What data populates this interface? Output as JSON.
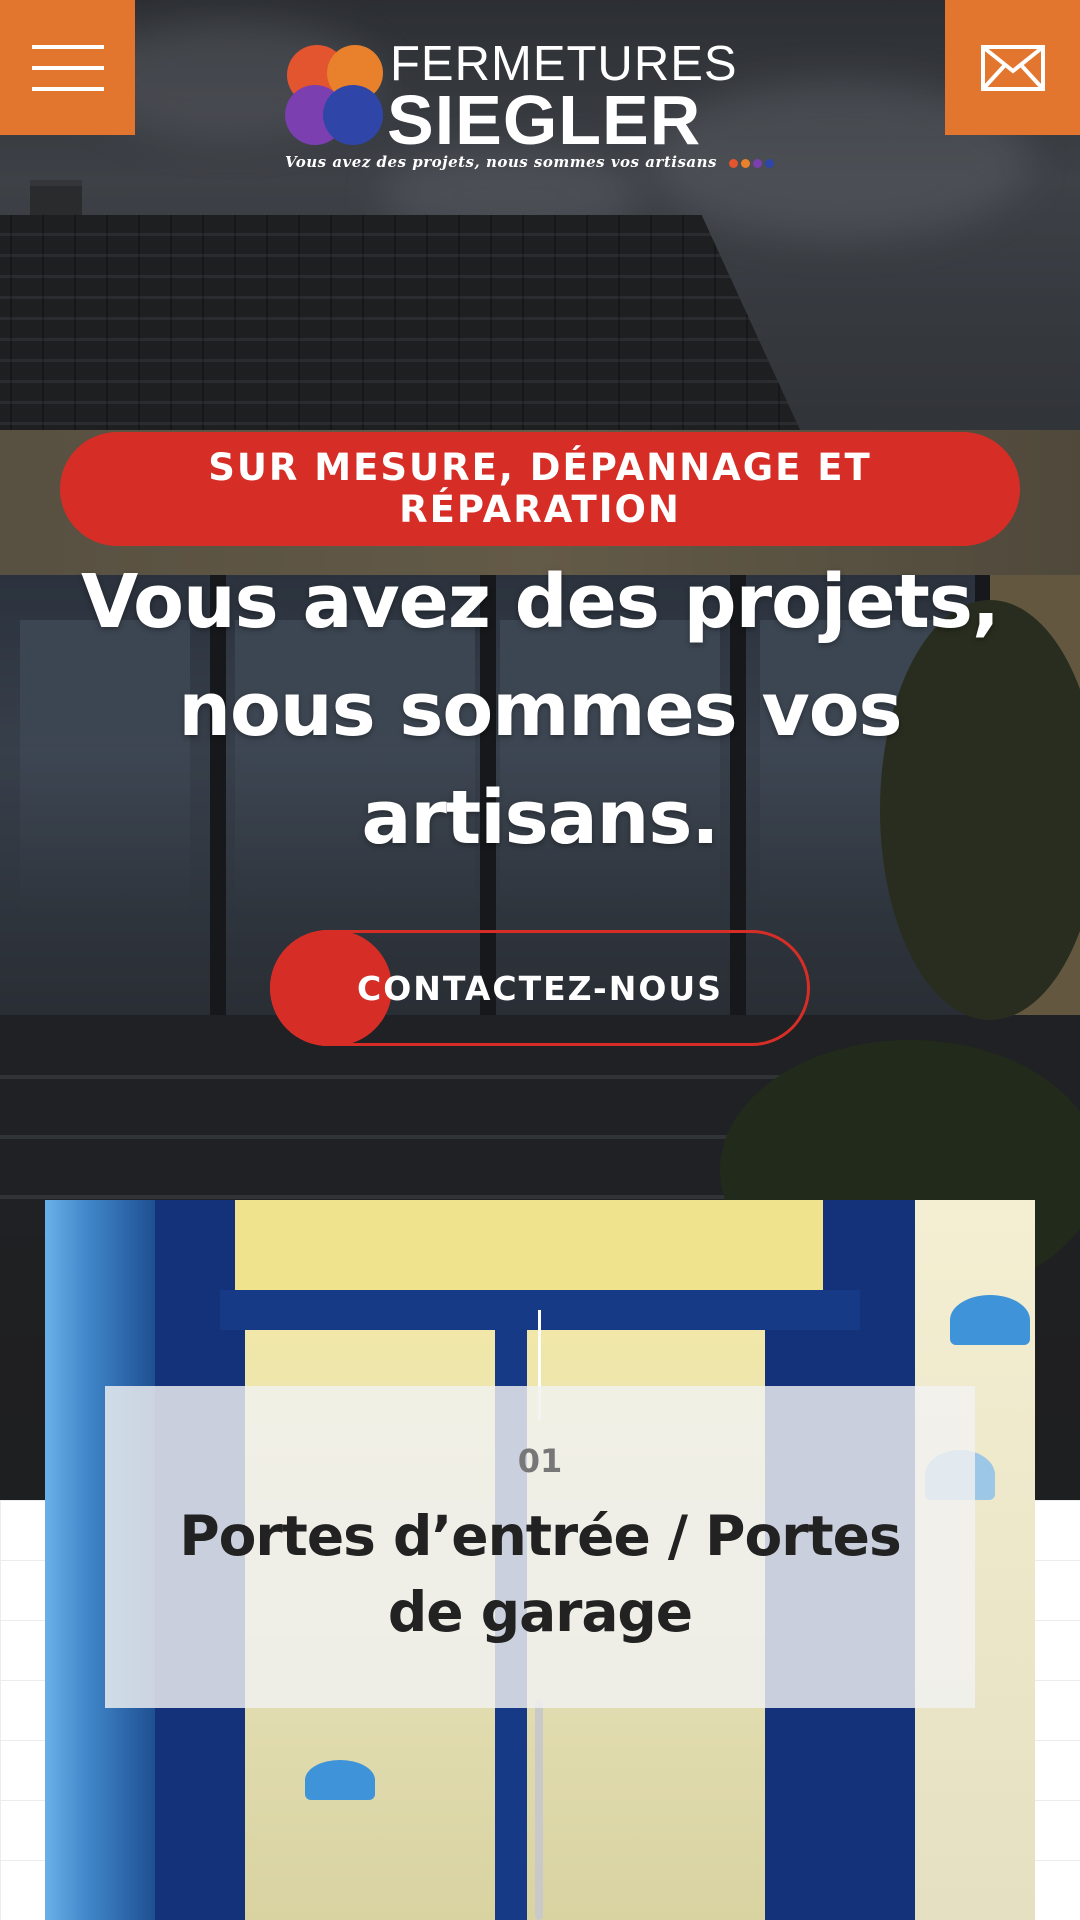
{
  "header": {
    "menu_icon": "hamburger-icon",
    "mail_icon": "envelope-icon",
    "accent_color": "#e2762e"
  },
  "logo": {
    "line1": "FERMETURES",
    "line2": "SIEGLER",
    "tagline": "Vous avez des projets, nous sommes vos artisans",
    "mark_colors": [
      "#e2552e",
      "#e8802c",
      "#7b3fb0",
      "#2f46a8"
    ]
  },
  "hero": {
    "badge": "SUR MESURE, DÉPANNAGE ET RÉPARATION",
    "headline": "Vous avez des projets, nous sommes vos artisans.",
    "cta_label": "CONTACTEZ-NOUS",
    "badge_color": "#d62e26"
  },
  "service_card": {
    "number": "01",
    "title": "Portes d’entrée / Portes de garage"
  }
}
